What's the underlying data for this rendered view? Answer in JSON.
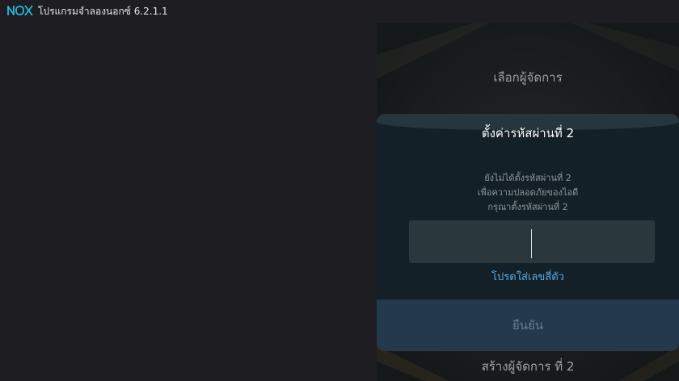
{
  "window": {
    "logo_text": "nox",
    "title": "โปรแกรมจำลองนอกซ์ 6.2.1.1"
  },
  "screen": {
    "heading": "เลือกผู้จัดการ",
    "footer": "สร้างผู้จัดการ ที่ 2"
  },
  "dialog": {
    "title": "ตั้งค่ารหัสผ่านที่ 2",
    "description": [
      "ยังไม่ได้ตั้งรหัสผ่านที่ 2",
      "เพื่อความปลอดภัยของไอดี",
      "กรุณาตั้งรหัสผ่านที่ 2"
    ],
    "input_value": "",
    "hint": "โปรดใส่เลขสี่ตัว",
    "confirm_label": "ยืนยัน"
  },
  "colors": {
    "accent": "#5aa9e6",
    "logo": "#27b8e0",
    "dialog_bg": "#142027",
    "button_bg": "#24394c"
  }
}
